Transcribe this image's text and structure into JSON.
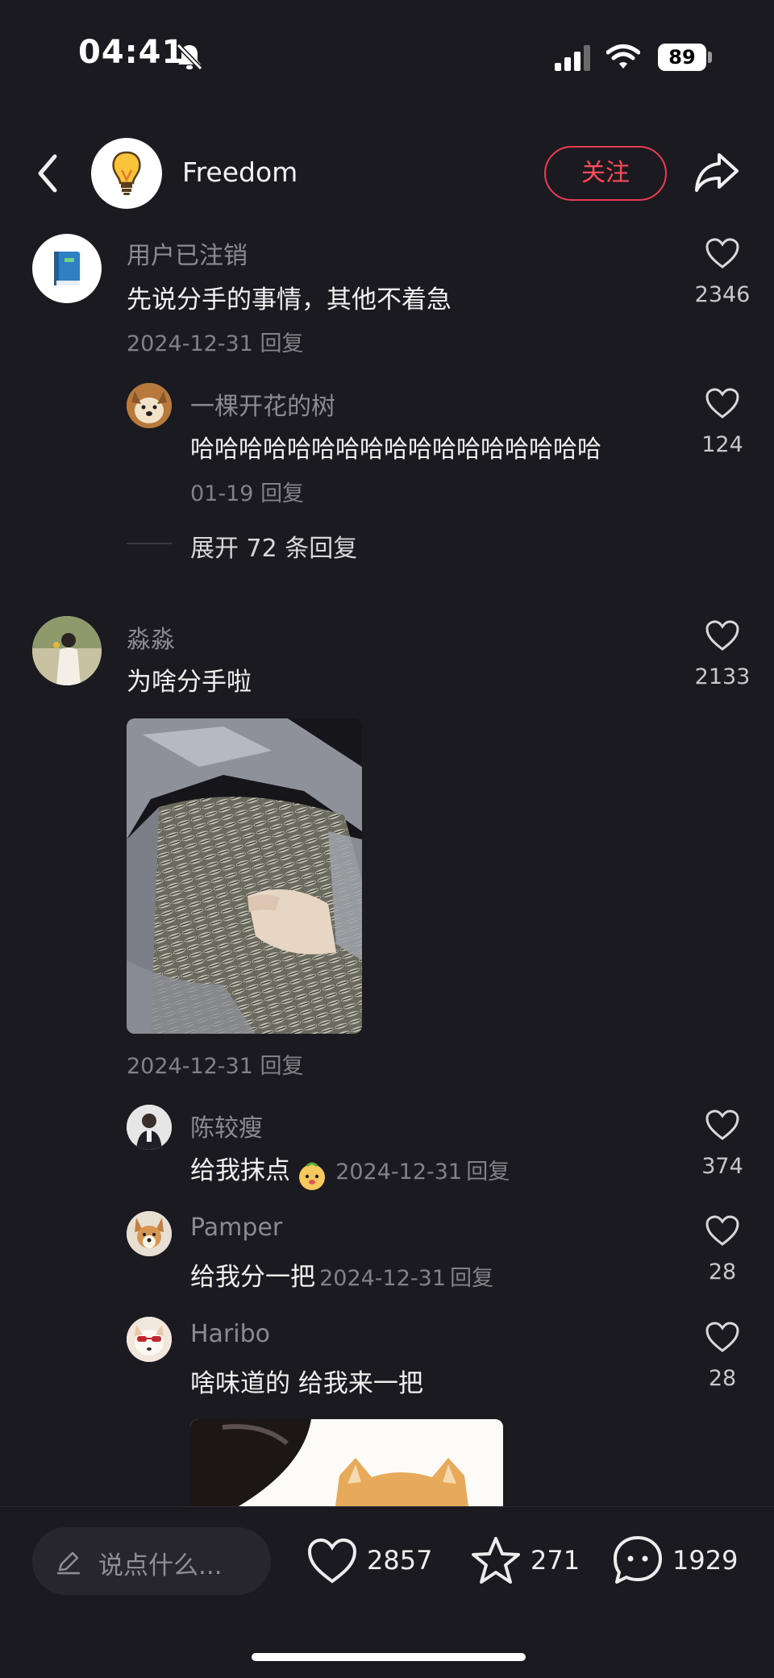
{
  "status": {
    "time": "04:41",
    "battery": "89"
  },
  "header": {
    "author": "Freedom",
    "follow_label": "关注"
  },
  "comments": [
    {
      "user": "用户已注销",
      "text": "先说分手的事情，其他不着急",
      "date": "2024-12-31",
      "reply": "回复",
      "likes": "2346",
      "replies": [
        {
          "user": "一棵开花的树",
          "text": "哈哈哈哈哈哈哈哈哈哈哈哈哈哈哈哈哈",
          "date": "01-19",
          "reply": "回复",
          "likes": "124"
        }
      ],
      "expand": "展开 72 条回复"
    },
    {
      "user": "淼淼",
      "text": "为啥分手啦",
      "date": "2024-12-31",
      "reply": "回复",
      "likes": "2133",
      "replies": [
        {
          "user": "陈较瘦",
          "text": "给我抹点",
          "date": "2024-12-31",
          "reply": "回复",
          "likes": "374"
        },
        {
          "user": "Pamper",
          "text": "给我分一把",
          "date": "2024-12-31",
          "reply": "回复",
          "likes": "28"
        },
        {
          "user": "Haribo",
          "text": "啥味道的 给我来一把",
          "likes": "28"
        }
      ]
    }
  ],
  "bottom": {
    "placeholder": "说点什么...",
    "likes": "2857",
    "favorites": "271",
    "comments": "1929"
  }
}
